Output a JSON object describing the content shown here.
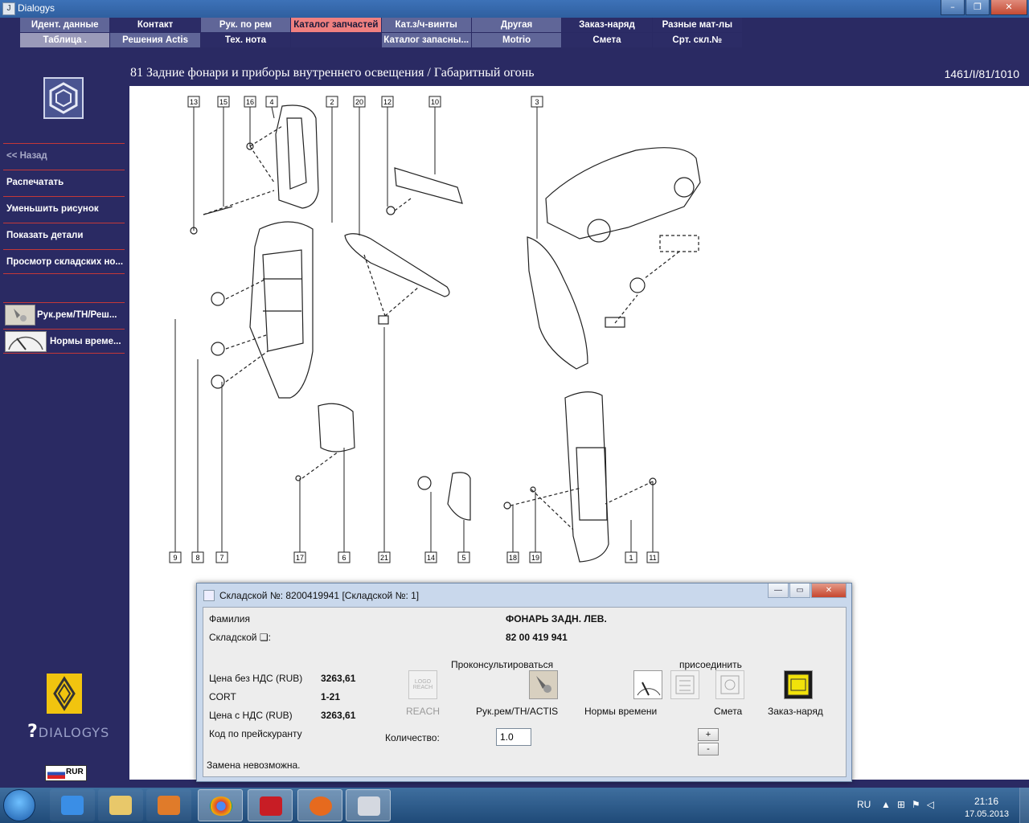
{
  "window": {
    "title": "Dialogys",
    "controls": [
      "–",
      "❐",
      "✕"
    ]
  },
  "menu": {
    "row1": [
      {
        "label": "Идент. данные",
        "state": "a"
      },
      {
        "label": "Контакт",
        "state": "b"
      },
      {
        "label": "Рук. по рем",
        "state": "a"
      },
      {
        "label": "Каталог запчастей",
        "state": "sel"
      },
      {
        "label": "Кат.з/ч-винты",
        "state": "a"
      },
      {
        "label": "Другая",
        "state": "a"
      },
      {
        "label": "Заказ-наряд",
        "state": "b"
      },
      {
        "label": "Разные мат-лы",
        "state": "b"
      }
    ],
    "row2": [
      {
        "label": "Таблица .",
        "state": "g"
      },
      {
        "label": "Решения Actis",
        "state": "a"
      },
      {
        "label": "Тех. нота",
        "state": "b"
      },
      {
        "label": "",
        "state": "b"
      },
      {
        "label": "Каталог запасны...",
        "state": "a"
      },
      {
        "label": "Motrio",
        "state": "a"
      },
      {
        "label": "Смета",
        "state": "b"
      },
      {
        "label": "Срт. скл.№",
        "state": "b"
      }
    ]
  },
  "sidebar": {
    "back": "<< Назад",
    "items": [
      "Распечатать",
      "Уменьшить рисунок",
      "Показать детали",
      "Просмотр складских но..."
    ],
    "image_items": [
      "Рук.рем/TH/Реш...",
      "Нормы време..."
    ],
    "brand": "DIALOGYS",
    "currency": "RUR"
  },
  "header": {
    "title": "81 Задние фонари и приборы внутреннего освещения / Габаритный огонь",
    "code": "1461/I/81/1010"
  },
  "diagram": {
    "top_callouts": [
      "13",
      "15",
      "16",
      "4",
      "2",
      "20",
      "12",
      "10",
      "3"
    ],
    "bottom_callouts": [
      "9",
      "8",
      "7",
      "17",
      "6",
      "21",
      "14",
      "5",
      "18",
      "19",
      "1",
      "11"
    ]
  },
  "dialog": {
    "title": "Складской №: 8200419941 [Складской №: 1]",
    "family_label": "Фамилия",
    "family_value": "ФОНАРЬ ЗАДН. ЛЕВ.",
    "part_label": "Складской ❏:",
    "part_value": "82 00 419 941",
    "price_net_label": "Цена без НДС (RUB)",
    "price_net_value": "3263,61",
    "cort_label": "CORT",
    "cort_value": "1-21",
    "price_gross_label": "Цена с НДС (RUB)",
    "price_gross_value": "3263,61",
    "pricelist_label": "Код по прейскуранту",
    "consult_label": "Проконсультироваться",
    "attach_label": "присоединить",
    "reach_label": "REACH",
    "reach_icon_text": "LOGO REACH",
    "manual_label": "Рук.рем/TH/ACTIS",
    "norms_label": "Нормы времени",
    "estimate_label": "Смета",
    "order_label": "Заказ-наряд",
    "qty_label": "Количество:",
    "qty_value": "1.0",
    "plus": "+",
    "minus": "-",
    "status": "Замена невозможна."
  },
  "taskbar": {
    "language": "RU",
    "time": "21:16",
    "date": "17.05.2013"
  }
}
